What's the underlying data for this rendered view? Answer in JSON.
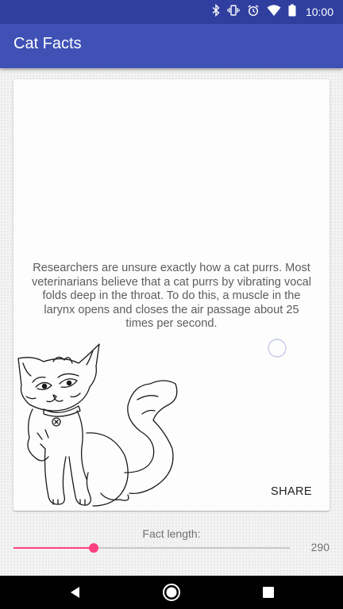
{
  "status_bar": {
    "time": "10:00",
    "icons": [
      "bluetooth-icon",
      "vibrate-icon",
      "alarm-icon",
      "wifi-icon",
      "battery-icon"
    ]
  },
  "app_bar": {
    "title": "Cat Facts"
  },
  "card": {
    "fact_text": "Researchers are unsure exactly how a cat purrs. Most veterinarians believe that a cat purrs by vibrating vocal folds deep in the throat. To do this, a muscle in the larynx opens and closes the air passage about 25 times per second.",
    "share_label": "SHARE",
    "image": "cat-illustration"
  },
  "fact_length": {
    "label": "Fact length:",
    "value": 290,
    "value_text": "290",
    "slider_fraction": 0.29
  },
  "nav_bar": {
    "icons": [
      "back-icon",
      "home-icon",
      "recents-icon"
    ]
  },
  "colors": {
    "status_bar": "#303f9f",
    "primary": "#3f51b5",
    "accent": "#ff4081",
    "nav_bar": "#000000"
  }
}
